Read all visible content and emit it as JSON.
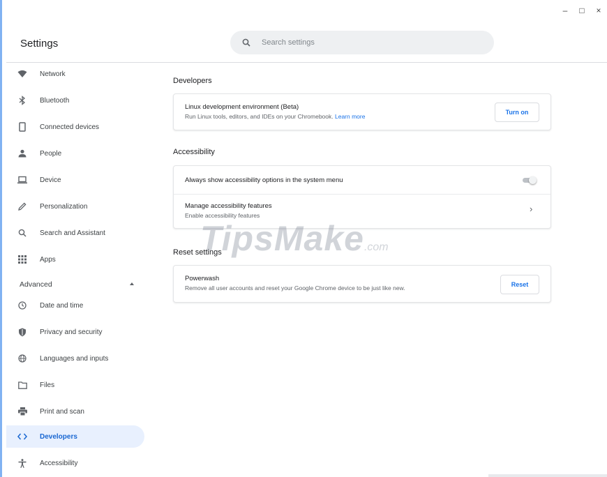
{
  "window_controls": {
    "minimize": "–",
    "maximize": "□",
    "close": "×"
  },
  "header": {
    "title": "Settings",
    "search_placeholder": "Search settings"
  },
  "sidebar": {
    "items": [
      {
        "label": "Network",
        "icon": "wifi-icon"
      },
      {
        "label": "Bluetooth",
        "icon": "bluetooth-icon"
      },
      {
        "label": "Connected devices",
        "icon": "phone-icon"
      },
      {
        "label": "People",
        "icon": "person-icon"
      },
      {
        "label": "Device",
        "icon": "laptop-icon"
      },
      {
        "label": "Personalization",
        "icon": "pencil-icon"
      },
      {
        "label": "Search and Assistant",
        "icon": "search-icon"
      },
      {
        "label": "Apps",
        "icon": "apps-grid-icon"
      }
    ],
    "advanced_label": "Advanced",
    "advanced_items": [
      {
        "label": "Date and time",
        "icon": "clock-icon"
      },
      {
        "label": "Privacy and security",
        "icon": "shield-icon"
      },
      {
        "label": "Languages and inputs",
        "icon": "globe-icon"
      },
      {
        "label": "Files",
        "icon": "folder-icon"
      },
      {
        "label": "Print and scan",
        "icon": "printer-icon"
      },
      {
        "label": "Developers",
        "icon": "code-icon",
        "active": true
      },
      {
        "label": "Accessibility",
        "icon": "accessibility-icon"
      }
    ]
  },
  "main": {
    "developers": {
      "title": "Developers",
      "linux": {
        "title": "Linux development environment (Beta)",
        "description": "Run Linux tools, editors, and IDEs on your Chromebook.",
        "link": "Learn more",
        "button": "Turn on"
      }
    },
    "accessibility": {
      "title": "Accessibility",
      "always_show": {
        "label": "Always show accessibility options in the system menu",
        "enabled": false
      },
      "manage": {
        "title": "Manage accessibility features",
        "subtitle": "Enable accessibility features",
        "chevron": "›"
      }
    },
    "reset": {
      "title": "Reset settings",
      "powerwash": {
        "title": "Powerwash",
        "description": "Remove all user accounts and reset your Google Chrome device to be just like new.",
        "button": "Reset"
      }
    }
  },
  "watermark": {
    "main": "TipsMake",
    "suffix": ".com"
  },
  "colors": {
    "accent": "#1a73e8",
    "active_bg": "#e8f0fe",
    "active_text": "#1967d2"
  }
}
